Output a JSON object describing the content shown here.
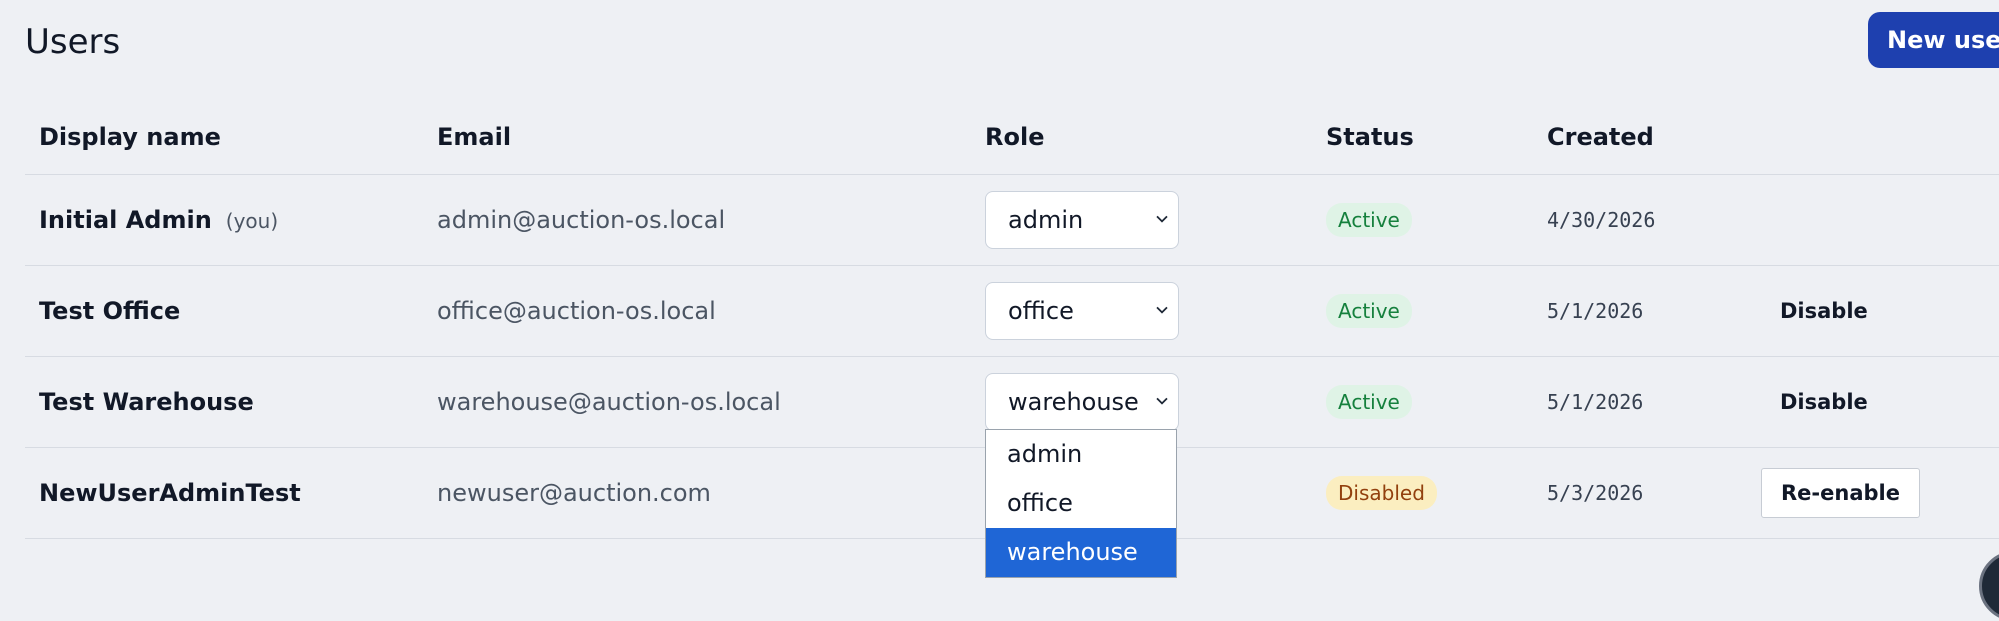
{
  "page": {
    "title": "Users",
    "new_user_label": "New user"
  },
  "columns": [
    "Display name",
    "Email",
    "Role",
    "Status",
    "Created"
  ],
  "users": [
    {
      "name": "Initial Admin",
      "you_tag": "(you)",
      "email": "admin@auction-os.local",
      "role": "admin",
      "status": "Active",
      "created": "4/30/2026",
      "action": ""
    },
    {
      "name": "Test Office",
      "you_tag": "",
      "email": "office@auction-os.local",
      "role": "office",
      "status": "Active",
      "created": "5/1/2026",
      "action": "Disable"
    },
    {
      "name": "Test Warehouse",
      "you_tag": "",
      "email": "warehouse@auction-os.local",
      "role": "warehouse",
      "status": "Active",
      "created": "5/1/2026",
      "action": "Disable"
    },
    {
      "name": "NewUserAdminTest",
      "you_tag": "",
      "email": "newuser@auction.com",
      "role": "",
      "status": "Disabled",
      "created": "5/3/2026",
      "action": "Re-enable"
    }
  ],
  "role_dropdown": {
    "options": [
      "admin",
      "office",
      "warehouse"
    ],
    "selected": "warehouse"
  },
  "colors": {
    "accent": "#1e40af",
    "active_badge_bg": "#dff3e6",
    "active_badge_text": "#15803d",
    "disabled_badge_bg": "#fbeec0",
    "disabled_badge_text": "#92400e",
    "dropdown_highlight": "#1f66d6"
  },
  "icons": {
    "select_arrow": "chevron-down-icon"
  }
}
